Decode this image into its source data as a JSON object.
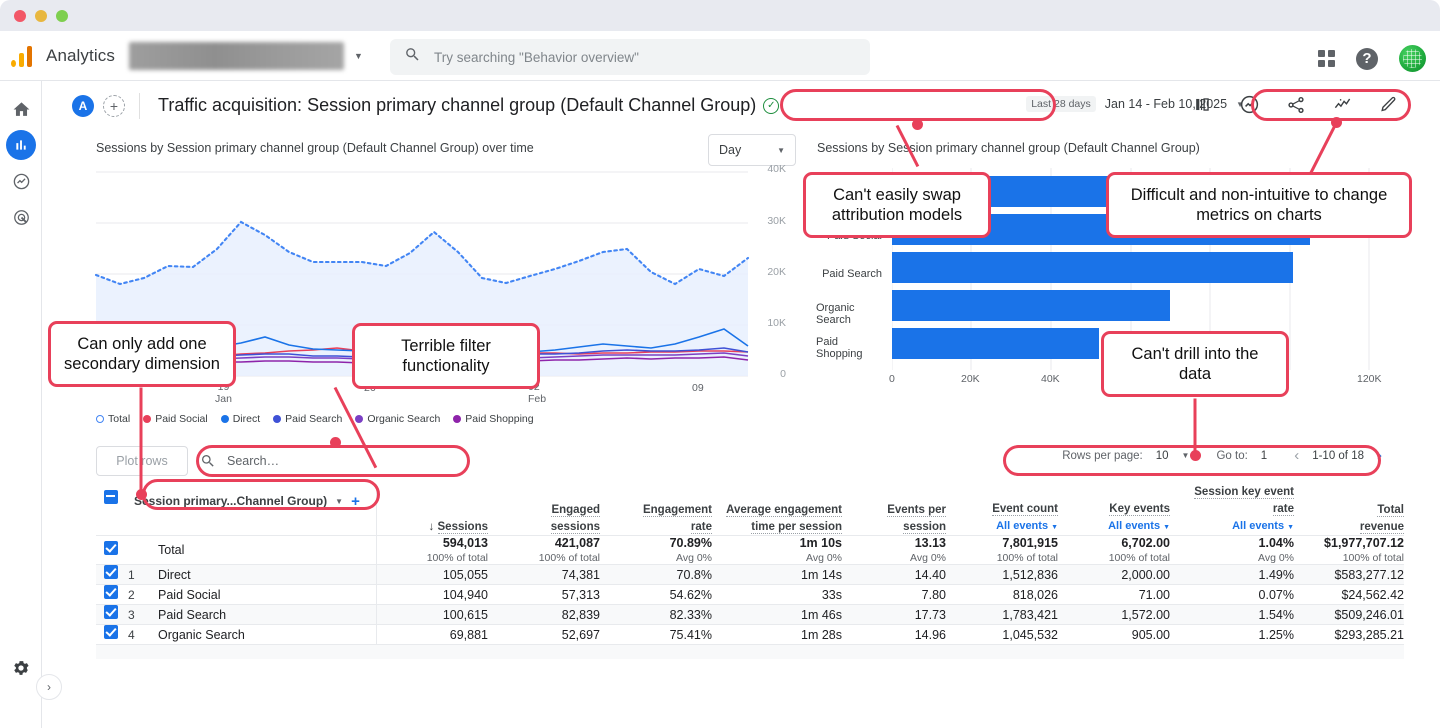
{
  "window": {
    "dots": [
      "close",
      "minimize",
      "maximize"
    ]
  },
  "topbar": {
    "product": "Analytics",
    "account_redacted": "",
    "search_placeholder": "Try searching \"Behavior overview\"",
    "icons": [
      "apps-grid-icon",
      "help-icon",
      "avatar-icon"
    ]
  },
  "rail": {
    "items": [
      {
        "name": "home-icon",
        "label": "Home"
      },
      {
        "name": "reports-icon",
        "label": "Reports"
      },
      {
        "name": "explore-icon",
        "label": "Explore"
      },
      {
        "name": "advertising-icon",
        "label": "Advertising"
      }
    ],
    "footer": {
      "gear": "settings-icon",
      "expand": "expand-icon",
      "expand_glyph": "›"
    }
  },
  "report_header": {
    "badge_letter": "A",
    "add_badge": "+",
    "title": "Traffic acquisition: Session primary channel group (Default Channel Group)",
    "verified_glyph": "✓",
    "add_comparison": "+",
    "date_chip": "Last 28 days",
    "date_range": "Jan 14 - Feb 10, 2025",
    "actions": [
      "compare-icon",
      "insights-icon",
      "share-icon",
      "trend-icon",
      "edit-icon"
    ]
  },
  "line_chart_panel": {
    "title": "Sessions by Session primary channel group (Default Channel Group) over time",
    "granularity": "Day"
  },
  "bar_chart_panel": {
    "title": "Sessions by Session primary channel group (Default Channel Group)"
  },
  "legend": [
    {
      "label": "Total",
      "color": "#4285f4",
      "hollow": true
    },
    {
      "label": "Paid Social",
      "color": "#e8405a",
      "hollow": false
    },
    {
      "label": "Direct",
      "color": "#1a73e8",
      "hollow": false
    },
    {
      "label": "Paid Search",
      "color": "#3f51d6",
      "hollow": false
    },
    {
      "label": "Organic Search",
      "color": "#7b3fc4",
      "hollow": false
    },
    {
      "label": "Paid Shopping",
      "color": "#8e24aa",
      "hollow": false
    }
  ],
  "chart_data": [
    {
      "type": "line",
      "title": "Sessions by Session primary channel group (Default Channel Group) over time",
      "xlabel": "",
      "ylabel": "Sessions",
      "ylim": [
        0,
        40000
      ],
      "yticks": [
        "0",
        "10K",
        "20K",
        "30K",
        "40K"
      ],
      "xticks": [
        "19\nJan",
        "26",
        "02\nFeb",
        "09"
      ],
      "grid": true,
      "legend_position": "bottom",
      "x": [
        1,
        2,
        3,
        4,
        5,
        6,
        7,
        8,
        9,
        10,
        11,
        12,
        13,
        14,
        15,
        16,
        17,
        18,
        19,
        20,
        21,
        22,
        23,
        24,
        25,
        26,
        27,
        28
      ],
      "series": [
        {
          "name": "Total",
          "style": "dotted-area",
          "color": "#4285f4",
          "values": [
            20100,
            18400,
            19600,
            21800,
            21600,
            25000,
            29700,
            27200,
            24000,
            22100,
            22000,
            22000,
            21300,
            24100,
            28200,
            24000,
            19200,
            18200,
            19600,
            21000,
            22600,
            24300,
            24900,
            20400,
            18000,
            21000,
            19700,
            23200
          ]
        },
        {
          "name": "Paid Social",
          "color": "#e8405a",
          "values": [
            4200,
            3600,
            3300,
            3100,
            3000,
            3200,
            3400,
            3600,
            3900,
            4100,
            4400,
            3900,
            3600,
            3400,
            3300,
            3200,
            3400,
            3500,
            3700,
            3600,
            3500,
            3600,
            3700,
            3800,
            3900,
            4000,
            4100,
            3900
          ]
        },
        {
          "name": "Direct",
          "color": "#1a73e8",
          "values": [
            5200,
            4600,
            4100,
            3800,
            4000,
            4600,
            5200,
            6500,
            5400,
            4700,
            4500,
            4400,
            4300,
            4500,
            4900,
            5300,
            5100,
            4600,
            4200,
            4500,
            5000,
            5500,
            5200,
            4800,
            5600,
            6800,
            8100,
            5200
          ]
        },
        {
          "name": "Paid Search",
          "color": "#3f51d6",
          "values": [
            4600,
            4100,
            3600,
            3200,
            2900,
            3000,
            3200,
            3400,
            3300,
            3100,
            3000,
            2900,
            2900,
            3100,
            3300,
            3600,
            3700,
            3400,
            3200,
            3300,
            3500,
            3800,
            3900,
            3700,
            3800,
            4000,
            4300,
            3600
          ]
        },
        {
          "name": "Organic Search",
          "color": "#7b3fc4",
          "values": [
            3900,
            3400,
            3000,
            2700,
            2500,
            2600,
            2700,
            2900,
            2900,
            2800,
            2700,
            2600,
            2600,
            2700,
            2900,
            3100,
            3200,
            3000,
            2800,
            2900,
            3000,
            3200,
            3300,
            3200,
            3300,
            3500,
            3700,
            3100
          ]
        },
        {
          "name": "Paid Shopping",
          "color": "#8e24aa",
          "values": [
            3200,
            2900,
            2500,
            2200,
            2000,
            2000,
            2100,
            2200,
            2200,
            2100,
            2000,
            1900,
            1900,
            2000,
            2200,
            2400,
            2500,
            2300,
            2200,
            2300,
            2400,
            2600,
            2700,
            2600,
            2700,
            2900,
            3100,
            2600
          ]
        }
      ]
    },
    {
      "type": "bar",
      "orientation": "horizontal",
      "title": "Sessions by Session primary channel group (Default Channel Group)",
      "xlabel": "",
      "ylabel": "",
      "xlim": [
        0,
        120000
      ],
      "xticks": [
        "0",
        "20K",
        "40K",
        "120K"
      ],
      "grid": true,
      "bar_color": "#1a73e8",
      "categories": [
        "Direct",
        "Paid Social",
        "Paid Search",
        "Organic Search",
        "Paid Shopping"
      ],
      "values": [
        105055,
        104940,
        100615,
        69881,
        52000
      ]
    }
  ],
  "table": {
    "toolbar": {
      "plot_rows_label": "Plot rows",
      "search_placeholder": "Search…",
      "rows_per_page_label": "Rows per page:",
      "rows_per_page_value": "10",
      "go_to_label": "Go to:",
      "go_to_value": "1",
      "range_label": "1-10 of 18"
    },
    "dimension_pill": "Session primary...Channel Group)",
    "columns": [
      {
        "label": "Sessions",
        "sorted": true,
        "sort_glyph": "↓",
        "sub": ""
      },
      {
        "label": "Engaged\nsessions",
        "sub": ""
      },
      {
        "label": "Engagement\nrate",
        "sub": ""
      },
      {
        "label": "Average engagement\ntime per session",
        "sub": ""
      },
      {
        "label": "Events per\nsession",
        "sub": ""
      },
      {
        "label": "Event count",
        "sub": "All events"
      },
      {
        "label": "Key events",
        "sub": "All events"
      },
      {
        "label": "Session key event\nrate",
        "sub": "All events"
      },
      {
        "label": "Total\nrevenue",
        "sub": ""
      }
    ],
    "total_row": {
      "name": "Total",
      "values": [
        "594,013",
        "421,087",
        "70.89%",
        "1m 10s",
        "13.13",
        "7,801,915",
        "6,702.00",
        "1.04%",
        "$1,977,707.12"
      ],
      "subs": [
        "100% of total",
        "100% of total",
        "Avg 0%",
        "Avg 0%",
        "Avg 0%",
        "100% of total",
        "100% of total",
        "Avg 0%",
        "100% of total"
      ]
    },
    "rows": [
      {
        "index": "1",
        "name": "Direct",
        "values": [
          "105,055",
          "74,381",
          "70.8%",
          "1m 14s",
          "14.40",
          "1,512,836",
          "2,000.00",
          "1.49%",
          "$583,277.12"
        ]
      },
      {
        "index": "2",
        "name": "Paid Social",
        "values": [
          "104,940",
          "57,313",
          "54.62%",
          "33s",
          "7.80",
          "818,026",
          "71.00",
          "0.07%",
          "$24,562.42"
        ]
      },
      {
        "index": "3",
        "name": "Paid Search",
        "values": [
          "100,615",
          "82,839",
          "82.33%",
          "1m 46s",
          "17.73",
          "1,783,421",
          "1,572.00",
          "1.54%",
          "$509,246.01"
        ]
      },
      {
        "index": "4",
        "name": "Organic Search",
        "values": [
          "69,881",
          "52,697",
          "75.41%",
          "1m 28s",
          "14.96",
          "1,045,532",
          "905.00",
          "1.25%",
          "$293,285.21"
        ]
      }
    ]
  },
  "annotations": [
    {
      "id": "swap-attribution",
      "text": "Can't easily swap attribution models"
    },
    {
      "id": "change-metrics",
      "text": "Difficult and non-intuitive to change metrics on charts"
    },
    {
      "id": "secondary-dimension",
      "text": "Can only add one secondary dimension"
    },
    {
      "id": "filter-functionality",
      "text": "Terrible filter functionality"
    },
    {
      "id": "drill-into-data",
      "text": "Can't drill into the data"
    }
  ],
  "colors": {
    "accent": "#1a73e8",
    "annotation": "#e8405a",
    "text": "#202124",
    "muted": "#5f6368"
  }
}
